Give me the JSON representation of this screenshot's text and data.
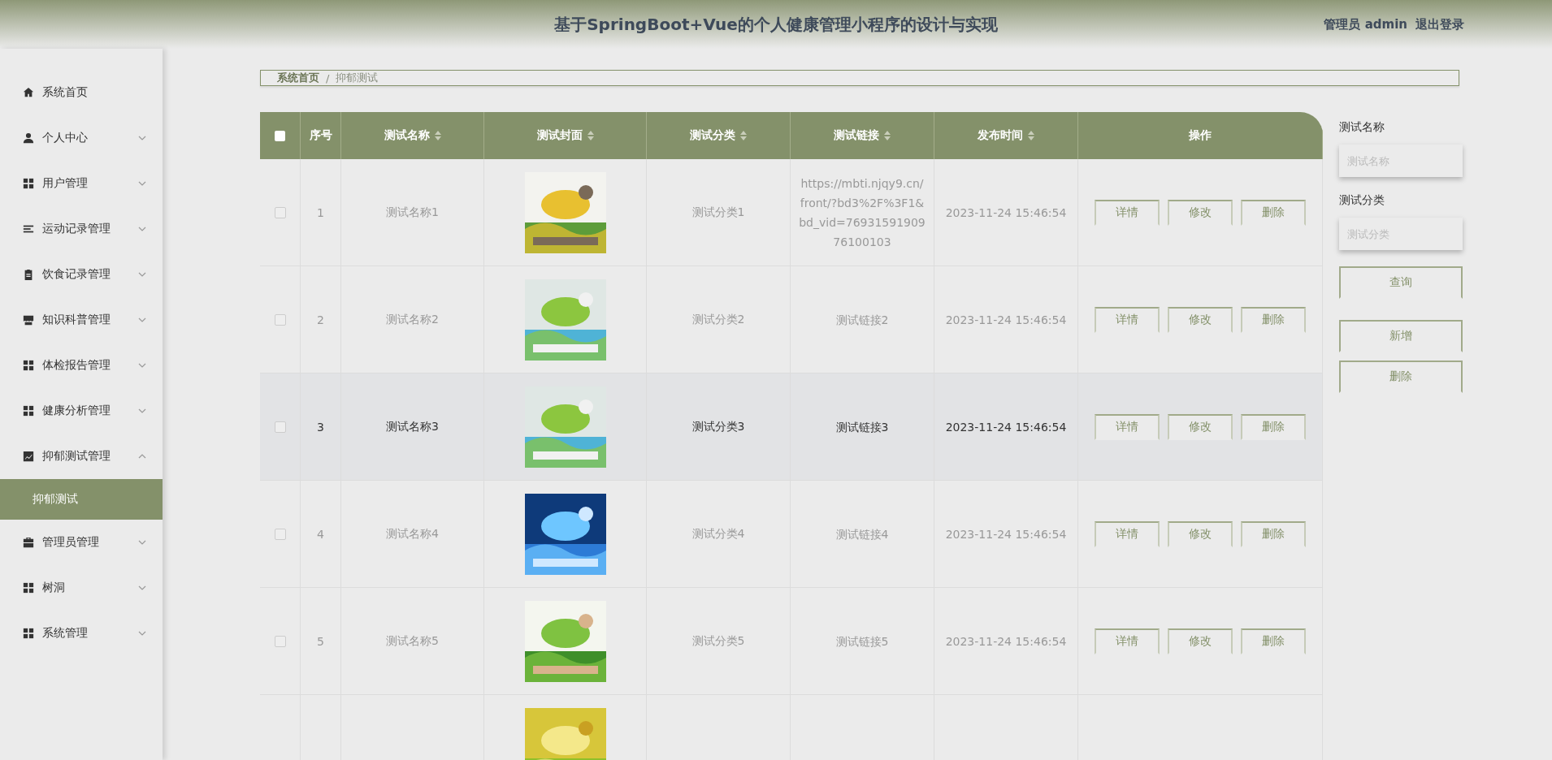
{
  "header": {
    "title": "基于SpringBoot+Vue的个人健康管理小程序的设计与实现",
    "user": "管理员 admin",
    "logout": "退出登录"
  },
  "sidebar": {
    "items": [
      {
        "label": "系统首页"
      },
      {
        "label": "个人中心",
        "expanded": false
      },
      {
        "label": "用户管理",
        "expanded": false
      },
      {
        "label": "运动记录管理",
        "expanded": false
      },
      {
        "label": "饮食记录管理",
        "expanded": false
      },
      {
        "label": "知识科普管理",
        "expanded": false
      },
      {
        "label": "体检报告管理",
        "expanded": false
      },
      {
        "label": "健康分析管理",
        "expanded": false
      },
      {
        "label": "抑郁测试管理",
        "expanded": true,
        "children": [
          {
            "label": "抑郁测试",
            "selected": true
          }
        ]
      },
      {
        "label": "管理员管理",
        "expanded": false
      },
      {
        "label": "树洞",
        "expanded": false
      },
      {
        "label": "系统管理",
        "expanded": false
      }
    ]
  },
  "breadcrumb": {
    "items": [
      "系统首页",
      "抑郁测试"
    ],
    "separator": "/"
  },
  "table": {
    "all_checked": false,
    "columns": [
      {
        "label": "序号",
        "sortable": false
      },
      {
        "label": "测试名称",
        "sortable": true
      },
      {
        "label": "测试封面",
        "sortable": true
      },
      {
        "label": "测试分类",
        "sortable": true
      },
      {
        "label": "测试链接",
        "sortable": true
      },
      {
        "label": "发布时间",
        "sortable": true
      },
      {
        "label": "操作",
        "sortable": false
      }
    ],
    "rows": [
      {
        "index": "1",
        "name": "测试名称1",
        "cover": {
          "kind": "picture"
        },
        "category": "测试分类1",
        "link": "https://mbti.njqy9.cn/front/?bd3%2F%3F1&bd_vid=7693159190976100103",
        "time": "2023-11-24 15:46:54",
        "actions": [
          "详情",
          "修改",
          "删除"
        ],
        "checked": false,
        "highlighted": false
      },
      {
        "index": "2",
        "name": "测试名称2",
        "cover": {
          "kind": "picture"
        },
        "category": "测试分类2",
        "link": "测试链接2",
        "time": "2023-11-24 15:46:54",
        "actions": [
          "详情",
          "修改",
          "删除"
        ],
        "checked": false,
        "highlighted": false
      },
      {
        "index": "3",
        "name": "测试名称3",
        "cover": {
          "kind": "picture"
        },
        "category": "测试分类3",
        "link": "测试链接3",
        "time": "2023-11-24 15:46:54",
        "actions": [
          "详情",
          "修改",
          "删除"
        ],
        "checked": false,
        "highlighted": true
      },
      {
        "index": "4",
        "name": "测试名称4",
        "cover": {
          "kind": "picture"
        },
        "category": "测试分类4",
        "link": "测试链接4",
        "time": "2023-11-24 15:46:54",
        "actions": [
          "详情",
          "修改",
          "删除"
        ],
        "checked": false,
        "highlighted": false
      },
      {
        "index": "5",
        "name": "测试名称5",
        "cover": {
          "kind": "picture"
        },
        "category": "测试分类5",
        "link": "测试链接5",
        "time": "2023-11-24 15:46:54",
        "actions": [
          "详情",
          "修改",
          "删除"
        ],
        "checked": false,
        "highlighted": false
      },
      {
        "cover": {
          "kind": "picture"
        }
      }
    ]
  },
  "search": {
    "fields": [
      {
        "label": "测试名称",
        "placeholder": "测试名称"
      },
      {
        "label": "测试分类",
        "placeholder": "测试分类"
      }
    ],
    "query_button": "查询",
    "buttons": [
      "新增",
      "删除"
    ]
  }
}
